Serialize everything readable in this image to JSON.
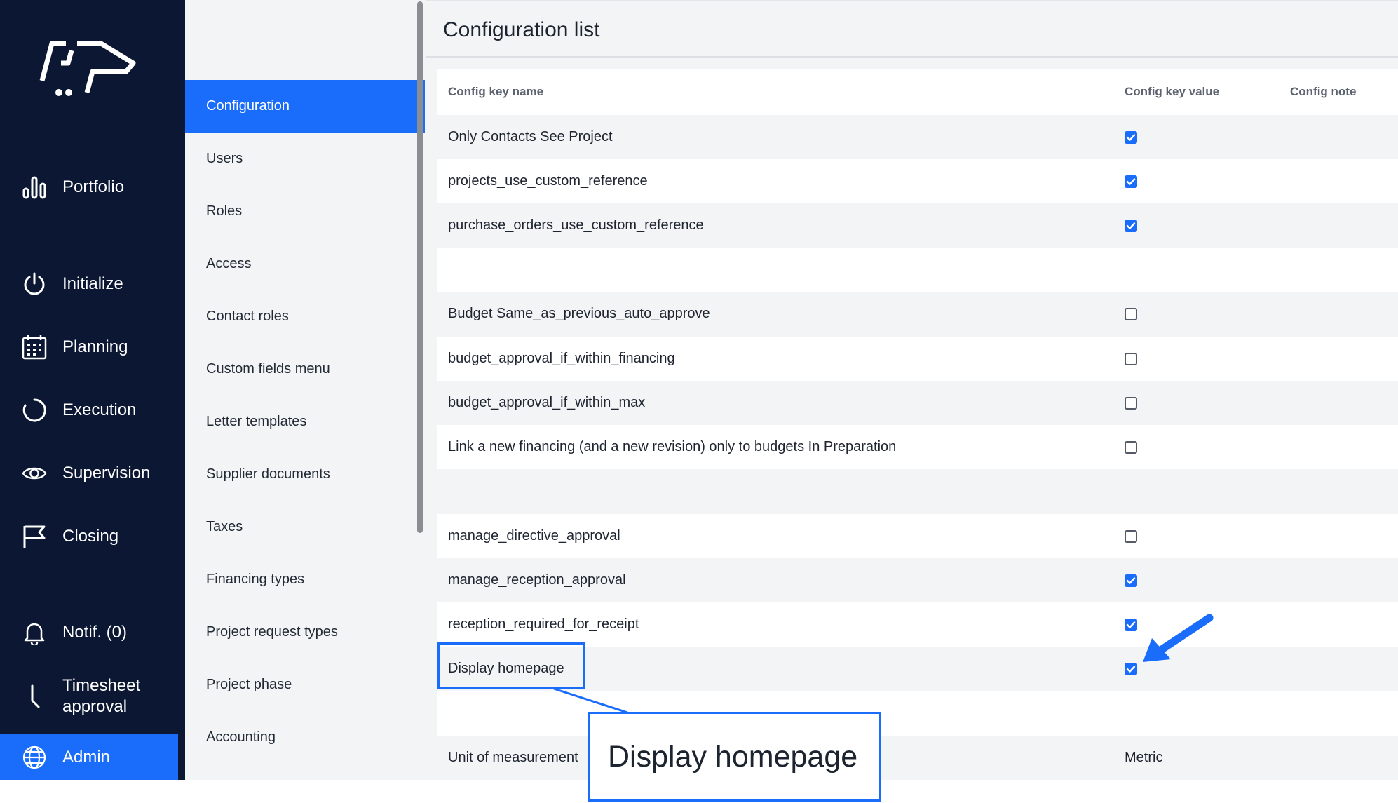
{
  "nav": {
    "items": [
      {
        "id": "portfolio",
        "label": "Portfolio",
        "icon": "bar-chart-icon"
      },
      {
        "id": "initialize",
        "label": "Initialize",
        "icon": "power-icon"
      },
      {
        "id": "planning",
        "label": "Planning",
        "icon": "calendar-icon"
      },
      {
        "id": "execution",
        "label": "Execution",
        "icon": "progress-circle-icon"
      },
      {
        "id": "supervision",
        "label": "Supervision",
        "icon": "eye-icon"
      },
      {
        "id": "closing",
        "label": "Closing",
        "icon": "flag-icon"
      },
      {
        "id": "notif",
        "label": "Notif. (0)",
        "icon": "bell-icon"
      },
      {
        "id": "timesheet",
        "label_line1": "Timesheet",
        "label_line2": "approval",
        "icon": "clock-hand-icon"
      },
      {
        "id": "admin",
        "label": "Admin",
        "icon": "globe-icon",
        "active": true
      }
    ]
  },
  "submenu": {
    "items": [
      {
        "label": "Configuration",
        "active": true
      },
      {
        "label": "Users"
      },
      {
        "label": "Roles"
      },
      {
        "label": "Access"
      },
      {
        "label": "Contact roles"
      },
      {
        "label": "Custom fields menu"
      },
      {
        "label": "Letter templates"
      },
      {
        "label": "Supplier documents"
      },
      {
        "label": "Taxes"
      },
      {
        "label": "Financing types"
      },
      {
        "label": "Project request types"
      },
      {
        "label": "Project phase"
      },
      {
        "label": "Accounting"
      }
    ]
  },
  "main": {
    "title": "Configuration list",
    "columns": [
      "Config key name",
      "Config key value",
      "Config note"
    ],
    "rows": [
      {
        "name": "Only Contacts See Project",
        "type": "checkbox",
        "checked": true
      },
      {
        "name": "projects_use_custom_reference",
        "type": "checkbox",
        "checked": true
      },
      {
        "name": "purchase_orders_use_custom_reference",
        "type": "checkbox",
        "checked": true
      },
      {
        "name": "",
        "type": "empty"
      },
      {
        "name": "Budget Same_as_previous_auto_approve",
        "type": "checkbox",
        "checked": false
      },
      {
        "name": "budget_approval_if_within_financing",
        "type": "checkbox",
        "checked": false
      },
      {
        "name": "budget_approval_if_within_max",
        "type": "checkbox",
        "checked": false
      },
      {
        "name": "Link a new financing (and a new revision) only to budgets In Preparation",
        "type": "checkbox",
        "checked": false
      },
      {
        "name": "",
        "type": "empty"
      },
      {
        "name": "manage_directive_approval",
        "type": "checkbox",
        "checked": false
      },
      {
        "name": "manage_reception_approval",
        "type": "checkbox",
        "checked": true
      },
      {
        "name": "reception_required_for_receipt",
        "type": "checkbox",
        "checked": true
      },
      {
        "name": "Display homepage",
        "type": "checkbox",
        "checked": true
      },
      {
        "name": "",
        "type": "empty"
      },
      {
        "name": "Unit of measurement",
        "type": "text",
        "value": "Metric"
      }
    ]
  },
  "callout": {
    "text": "Display homepage"
  },
  "colors": {
    "nav_bg": "#0b1733",
    "accent": "#1a6cfb",
    "panel_bg": "#f3f4f6"
  }
}
